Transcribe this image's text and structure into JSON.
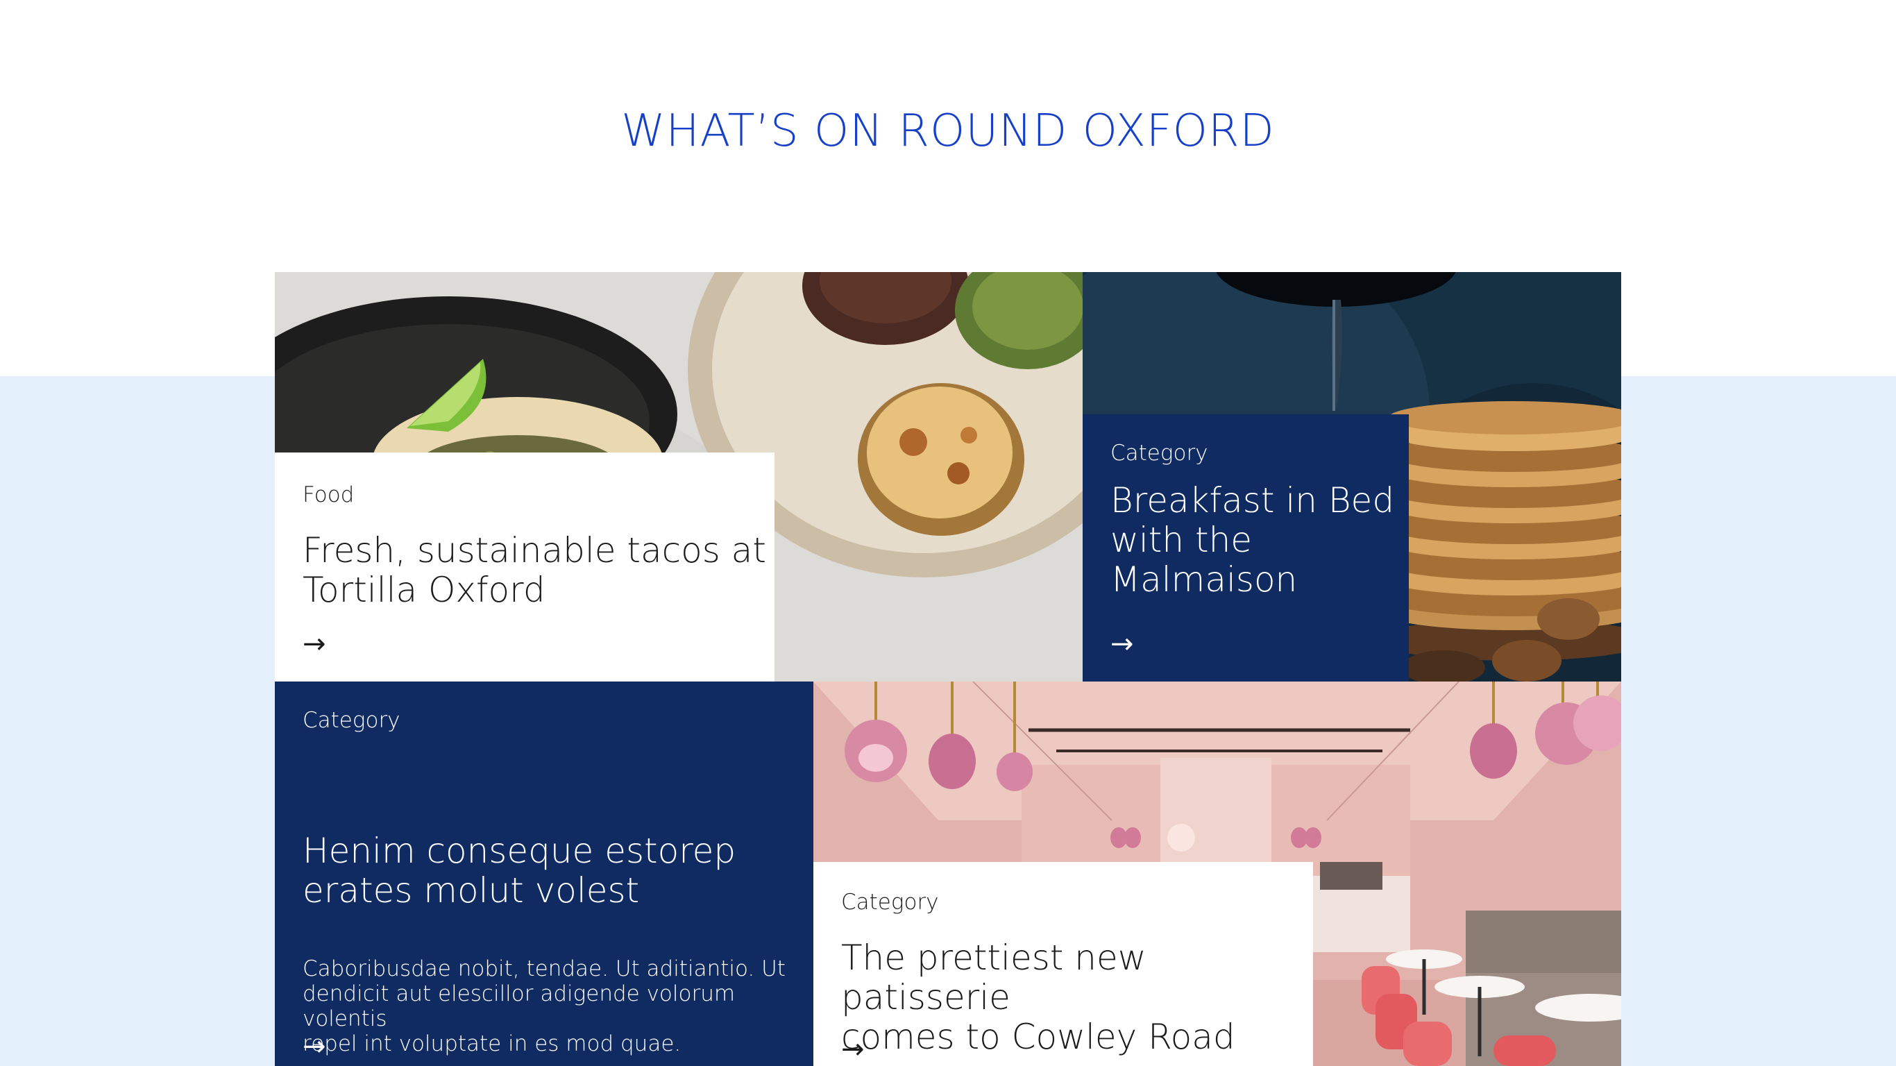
{
  "section": {
    "title": "WHAT’S ON ROUND OXFORD"
  },
  "cards": [
    {
      "category": "Food",
      "headline_line1": "Fresh, sustainable tacos at",
      "headline_line2": "Tortilla Oxford",
      "arrow": "→"
    },
    {
      "category": "Category",
      "headline_line1": "Breakfast in Bed",
      "headline_line2": "with the",
      "headline_line3": "Malmaison",
      "arrow": "→"
    },
    {
      "category": "Category",
      "headline_line1": "Henim conseque estorep",
      "headline_line2": "erates molut volest",
      "desc_line1": "Caboribusdae nobit, tendae. Ut aditiantio. Ut",
      "desc_line2": "dendicit aut elescillor adigende volorum volentis",
      "desc_line3": "repel int voluptate in es mod quae.",
      "arrow": "→"
    },
    {
      "category": "Category",
      "headline_line1": "The prettiest new patisserie",
      "headline_line2": "comes to Cowley Road",
      "arrow": "→"
    }
  ],
  "colors": {
    "title_blue": "#1640c8",
    "navy": "#0f2b62",
    "band": "#e4f0fb"
  }
}
